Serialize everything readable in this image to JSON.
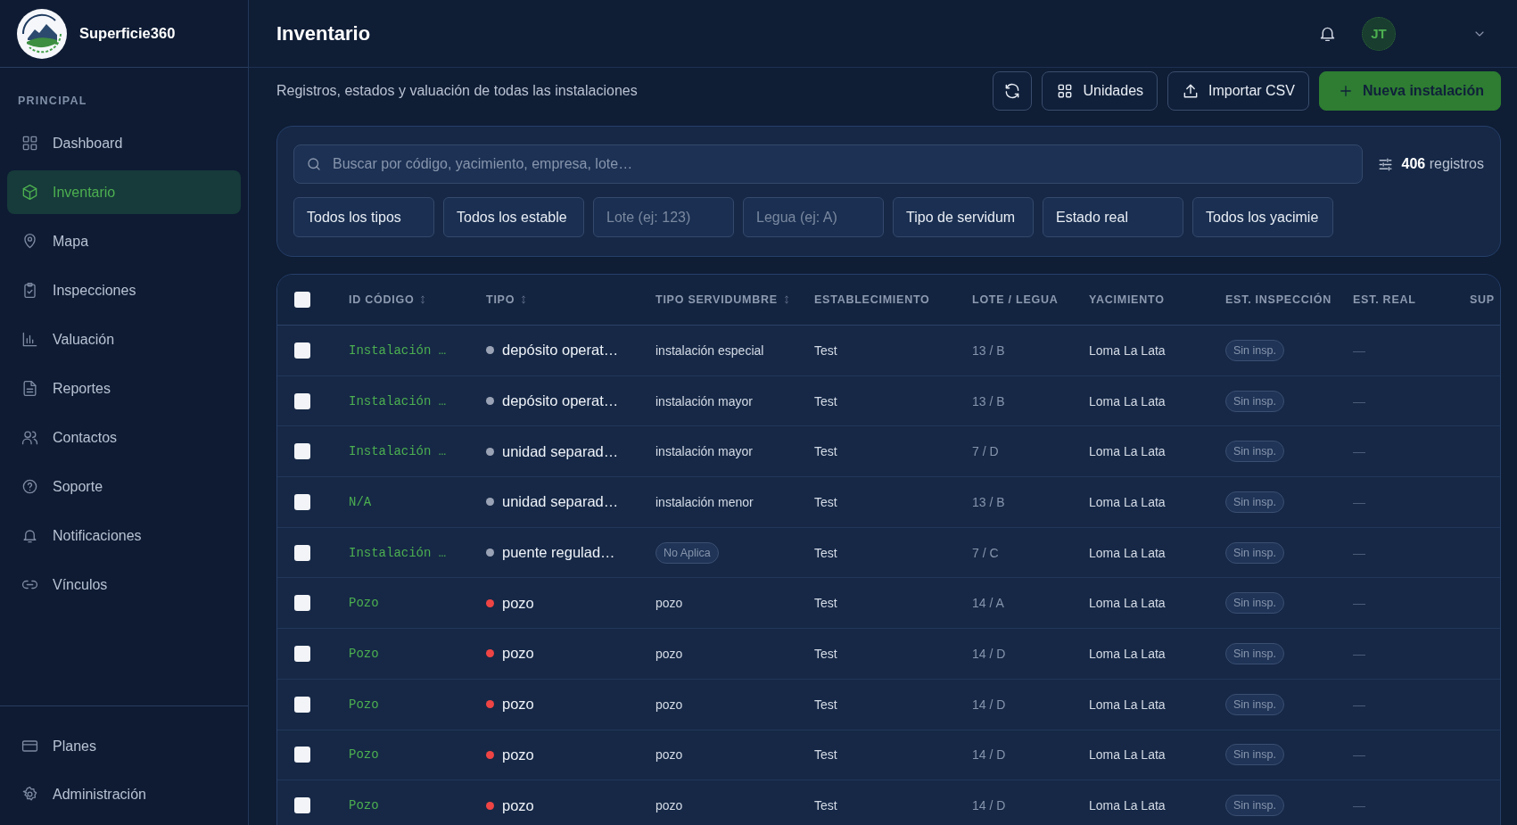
{
  "brand": {
    "name": "Superficie360"
  },
  "sidebar": {
    "section": "PRINCIPAL",
    "items": [
      {
        "label": "Dashboard",
        "selected": false
      },
      {
        "label": "Inventario",
        "selected": true
      },
      {
        "label": "Mapa",
        "selected": false
      },
      {
        "label": "Inspecciones",
        "selected": false
      },
      {
        "label": "Valuación",
        "selected": false
      },
      {
        "label": "Reportes",
        "selected": false
      },
      {
        "label": "Contactos",
        "selected": false
      },
      {
        "label": "Soporte",
        "selected": false
      },
      {
        "label": "Notificaciones",
        "selected": false
      },
      {
        "label": "Vínculos",
        "selected": false
      }
    ],
    "bottom_items": [
      {
        "label": "Planes",
        "selected": false
      },
      {
        "label": "Administración",
        "selected": false
      }
    ]
  },
  "header": {
    "title": "Inventario",
    "avatar": "JT"
  },
  "subtitle": "Registros, estados y valuación de todas las instalaciones",
  "actions": [
    {
      "kind": "icon"
    },
    {
      "kind": "grid",
      "label": "Unidades"
    },
    {
      "kind": "upload",
      "label": "Importar CSV"
    },
    {
      "kind": "primary",
      "label": "Nueva instalación"
    }
  ],
  "search": {
    "placeholder": "Buscar por código, yacimiento, empresa, lote…"
  },
  "record_count": "**406** registros",
  "filters": [
    {
      "kind": "select",
      "value": "Todos los tipos"
    },
    {
      "kind": "select",
      "value": "Todos los estable"
    },
    {
      "kind": "input",
      "placeholder": "Lote (ej: 123)"
    },
    {
      "kind": "input",
      "placeholder": "Legua (ej: A)"
    },
    {
      "kind": "select",
      "value": "Tipo de servidum"
    },
    {
      "kind": "select",
      "value": "Estado real"
    },
    {
      "kind": "select",
      "value": "Todos los yacimie"
    }
  ],
  "table": {
    "all_checked": false,
    "columns": [
      {
        "label": "ID CÓDIGO",
        "sortable": true
      },
      {
        "label": "TIPO",
        "sortable": true
      },
      {
        "label": "TIPO SERVIDUMBRE",
        "sortable": true
      },
      {
        "label": "ESTABLECIMIENTO",
        "sortable": false
      },
      {
        "label": "LOTE / LEGUA",
        "sortable": false
      },
      {
        "label": "YACIMIENTO",
        "sortable": false
      },
      {
        "label": "EST. INSPECCIÓN",
        "sortable": false
      },
      {
        "label": "EST. REAL",
        "sortable": false
      },
      {
        "label": "SUP",
        "sortable": false
      }
    ],
    "rows": [
      {
        "checked": false,
        "id": "Instalación …",
        "tipo": "depósito operat…",
        "color": "#9aa3b5",
        "servidumbre": {
          "kind": "text",
          "text": "instalación especial"
        },
        "establecimiento": "Test",
        "lote": "13 / B",
        "yacimiento": "Loma La Lata",
        "inspeccion": "Sin insp.",
        "real": "—"
      },
      {
        "checked": false,
        "id": "Instalación …",
        "tipo": "depósito operat…",
        "color": "#9aa3b5",
        "servidumbre": {
          "kind": "text",
          "text": "instalación mayor"
        },
        "establecimiento": "Test",
        "lote": "13 / B",
        "yacimiento": "Loma La Lata",
        "inspeccion": "Sin insp.",
        "real": "—"
      },
      {
        "checked": false,
        "id": "Instalación …",
        "tipo": "unidad separad…",
        "color": "#9aa3b5",
        "servidumbre": {
          "kind": "text",
          "text": "instalación mayor"
        },
        "establecimiento": "Test",
        "lote": "7 / D",
        "yacimiento": "Loma La Lata",
        "inspeccion": "Sin insp.",
        "real": "—"
      },
      {
        "checked": false,
        "id": "N/A",
        "tipo": "unidad separad…",
        "color": "#9aa3b5",
        "servidumbre": {
          "kind": "text",
          "text": "instalación menor"
        },
        "establecimiento": "Test",
        "lote": "13 / B",
        "yacimiento": "Loma La Lata",
        "inspeccion": "Sin insp.",
        "real": "—"
      },
      {
        "checked": false,
        "id": "Instalación …",
        "tipo": "puente regulad…",
        "color": "#9aa3b5",
        "servidumbre": {
          "kind": "badge",
          "text": "No Aplica"
        },
        "establecimiento": "Test",
        "lote": "7 / C",
        "yacimiento": "Loma La Lata",
        "inspeccion": "Sin insp.",
        "real": "—"
      },
      {
        "checked": false,
        "id": "Pozo",
        "tipo": "pozo",
        "color": "#ef4444",
        "servidumbre": {
          "kind": "text",
          "text": "pozo"
        },
        "establecimiento": "Test",
        "lote": "14 / A",
        "yacimiento": "Loma La Lata",
        "inspeccion": "Sin insp.",
        "real": "—"
      },
      {
        "checked": false,
        "id": "Pozo",
        "tipo": "pozo",
        "color": "#ef4444",
        "servidumbre": {
          "kind": "text",
          "text": "pozo"
        },
        "establecimiento": "Test",
        "lote": "14 / D",
        "yacimiento": "Loma La Lata",
        "inspeccion": "Sin insp.",
        "real": "—"
      },
      {
        "checked": false,
        "id": "Pozo",
        "tipo": "pozo",
        "color": "#ef4444",
        "servidumbre": {
          "kind": "text",
          "text": "pozo"
        },
        "establecimiento": "Test",
        "lote": "14 / D",
        "yacimiento": "Loma La Lata",
        "inspeccion": "Sin insp.",
        "real": "—"
      },
      {
        "checked": false,
        "id": "Pozo",
        "tipo": "pozo",
        "color": "#ef4444",
        "servidumbre": {
          "kind": "text",
          "text": "pozo"
        },
        "establecimiento": "Test",
        "lote": "14 / D",
        "yacimiento": "Loma La Lata",
        "inspeccion": "Sin insp.",
        "real": "—"
      },
      {
        "checked": false,
        "id": "Pozo",
        "tipo": "pozo",
        "color": "#ef4444",
        "servidumbre": {
          "kind": "text",
          "text": "pozo"
        },
        "establecimiento": "Test",
        "lote": "14 / D",
        "yacimiento": "Loma La Lata",
        "inspeccion": "Sin insp.",
        "real": "—"
      }
    ]
  }
}
